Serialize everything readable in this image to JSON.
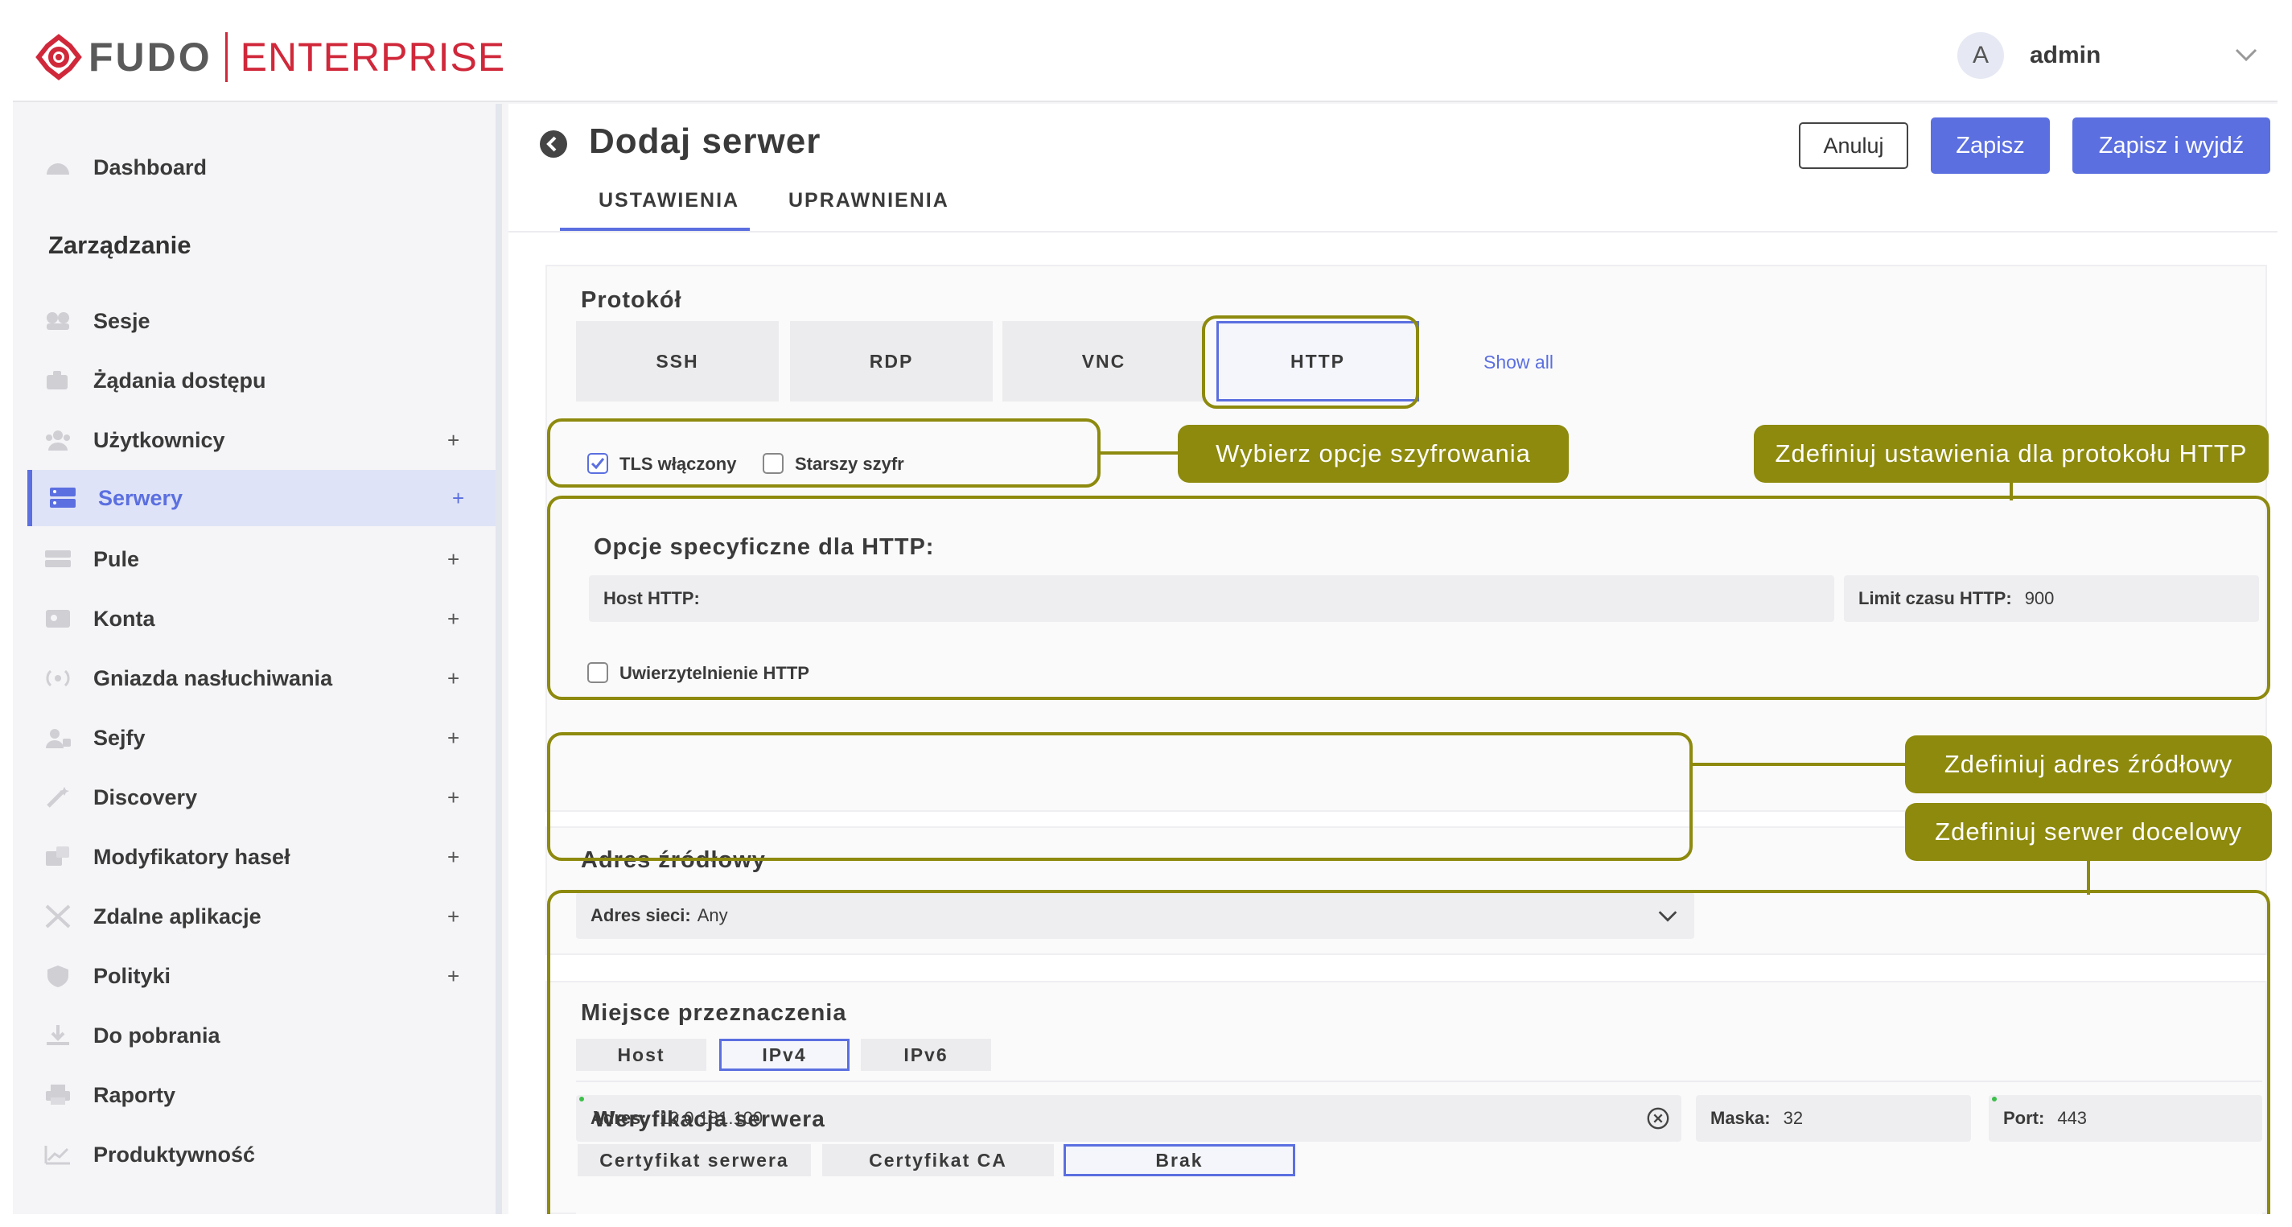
{
  "header": {
    "brand": "FUDO",
    "edition": "ENTERPRISE",
    "user_initial": "A",
    "user_name": "admin"
  },
  "sidebar": {
    "top_item": "Dashboard",
    "section_title": "Zarządzanie",
    "items": [
      {
        "label": "Sesje",
        "icon": "sessions-icon",
        "plus": ""
      },
      {
        "label": "Żądania dostępu",
        "icon": "access-requests-icon",
        "plus": ""
      },
      {
        "label": "Użytkownicy",
        "icon": "users-icon",
        "plus": "+"
      },
      {
        "label": "Serwery",
        "icon": "servers-icon",
        "plus": "+"
      },
      {
        "label": "Pule",
        "icon": "pools-icon",
        "plus": "+"
      },
      {
        "label": "Konta",
        "icon": "accounts-icon",
        "plus": "+"
      },
      {
        "label": "Gniazda nasłuchiwania",
        "icon": "listeners-icon",
        "plus": "+"
      },
      {
        "label": "Sejfy",
        "icon": "safes-icon",
        "plus": "+"
      },
      {
        "label": "Discovery",
        "icon": "discovery-icon",
        "plus": "+"
      },
      {
        "label": "Modyfikatory haseł",
        "icon": "password-changers-icon",
        "plus": "+"
      },
      {
        "label": "Zdalne aplikacje",
        "icon": "remote-apps-icon",
        "plus": "+"
      },
      {
        "label": "Polityki",
        "icon": "policies-icon",
        "plus": "+"
      },
      {
        "label": "Do pobrania",
        "icon": "download-icon",
        "plus": ""
      },
      {
        "label": "Raporty",
        "icon": "reports-icon",
        "plus": ""
      },
      {
        "label": "Produktywność",
        "icon": "productivity-icon",
        "plus": ""
      }
    ],
    "active_item": "Serwery"
  },
  "page": {
    "title": "Dodaj serwer",
    "cancel_label": "Anuluj",
    "save_label": "Zapisz",
    "save_exit_label": "Zapisz i wyjdź",
    "tabs": [
      "USTAWIENIA",
      "UPRAWNIENIA"
    ],
    "active_tab": "USTAWIENIA"
  },
  "protocol": {
    "label": "Protokół",
    "options": [
      "SSH",
      "RDP",
      "VNC",
      "HTTP"
    ],
    "selected": "HTTP",
    "show_all": "Show all",
    "tls_label": "TLS włączony",
    "tls_checked": true,
    "legacy_cipher_label": "Starszy szyfr",
    "legacy_cipher_checked": false
  },
  "http_options": {
    "title": "Opcje specyficzne dla HTTP:",
    "host_label": "Host HTTP:",
    "host_value": "",
    "timeout_label": "Limit czasu HTTP:",
    "timeout_value": "900",
    "auth_label": "Uwierzytelnienie HTTP",
    "auth_checked": false
  },
  "source": {
    "title": "Adres źródłowy",
    "network_label": "Adres sieci:",
    "network_value": "Any"
  },
  "destination": {
    "title": "Miejsce przeznaczenia",
    "options": [
      "Host",
      "IPv4",
      "IPv6"
    ],
    "selected": "IPv4",
    "address_label": "Adres:",
    "address_value": "10.0.181.100",
    "mask_label": "Maska:",
    "mask_value": "32",
    "port_label": "Port:",
    "port_value": "443"
  },
  "verification": {
    "title": "Weryfikacja serwera",
    "options": [
      "Certyfikat serwera",
      "Certyfikat CA",
      "Brak"
    ],
    "selected": "Brak"
  },
  "annotations": {
    "encryption": "Wybierz opcje szyfrowania",
    "http_settings": "Zdefiniuj ustawienia dla protokołu HTTP",
    "source_address": "Zdefiniuj adres źródłowy",
    "target_server": "Zdefiniuj serwer docelowy"
  },
  "colors": {
    "accent": "#5b6fe0",
    "brand_red": "#d0283a",
    "annotation": "#8d8a0e"
  }
}
